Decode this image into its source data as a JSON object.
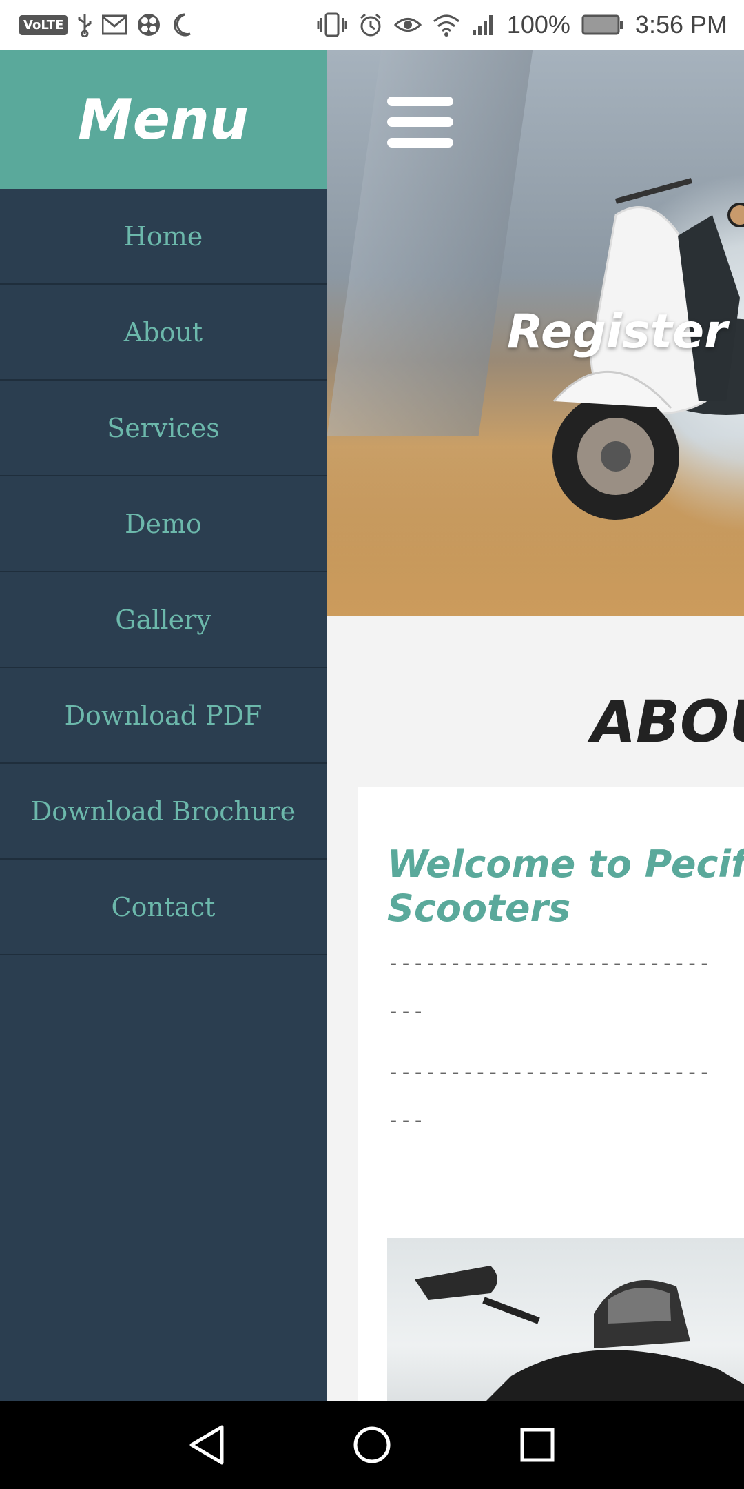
{
  "status_bar": {
    "volte": "VoLTE",
    "battery_percent": "100%",
    "time": "3:56 PM",
    "icons_left": [
      "volte-icon",
      "usb-icon",
      "gmail-icon",
      "game-icon",
      "moon-icon"
    ],
    "icons_right": [
      "vibrate-icon",
      "alarm-icon",
      "eye-icon",
      "wifi-icon",
      "signal-icon",
      "battery-icon"
    ]
  },
  "drawer": {
    "title": "Menu",
    "items": [
      {
        "label": "Home"
      },
      {
        "label": "About"
      },
      {
        "label": "Services"
      },
      {
        "label": "Demo"
      },
      {
        "label": "Gallery"
      },
      {
        "label": "Download PDF"
      },
      {
        "label": "Download Brochure"
      },
      {
        "label": "Contact"
      }
    ]
  },
  "hero": {
    "title": "Register"
  },
  "about": {
    "section_title": "ABOU",
    "welcome_line1": "Welcome to Pecifi",
    "welcome_line2": "Scooters",
    "dash_line1": "--------------------------",
    "dash_line2": "---",
    "dash_line3": "--------------------------",
    "dash_line4": "---"
  },
  "colors": {
    "accent": "#5aa99b",
    "drawer_bg": "#2b3e50",
    "menu_text": "#6cb8ab"
  },
  "navbar": {
    "buttons": [
      "back-icon",
      "home-icon",
      "recents-icon"
    ]
  }
}
